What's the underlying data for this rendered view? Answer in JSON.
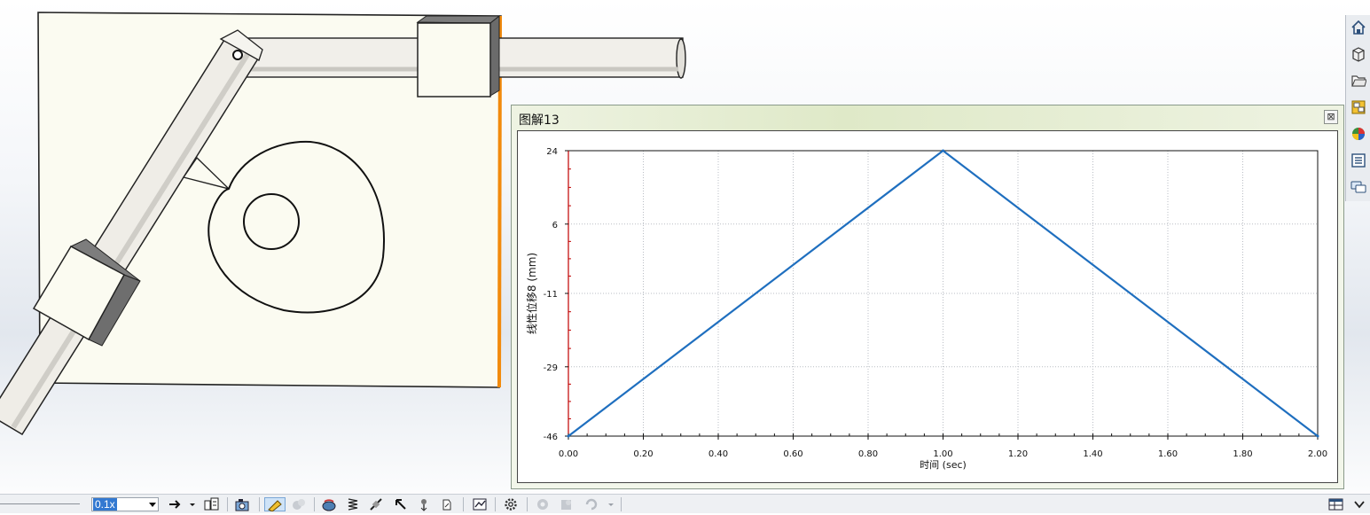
{
  "plot_window": {
    "title": "图解13",
    "close_glyph": "⊠"
  },
  "chart_data": {
    "type": "line",
    "title": "",
    "xlabel": "时间 (sec)",
    "ylabel": "线性位移8 (mm)",
    "xlim": [
      0,
      2
    ],
    "ylim": [
      -46,
      24
    ],
    "x_ticks": [
      0.0,
      0.2,
      0.4,
      0.6,
      0.8,
      1.0,
      1.2,
      1.4,
      1.6,
      1.8,
      2.0
    ],
    "x_tick_labels": [
      "0.00",
      "0.20",
      "0.40",
      "0.60",
      "0.80",
      "1.00",
      "1.20",
      "1.40",
      "1.60",
      "1.80",
      "2.00"
    ],
    "y_ticks": [
      24,
      6,
      -11,
      -29,
      -46
    ],
    "y_tick_labels": [
      "24",
      "6",
      "-11",
      "-29",
      "-46"
    ],
    "grid": true,
    "series": [
      {
        "x": [
          0.0,
          1.0,
          2.0
        ],
        "y": [
          -46,
          24,
          -46
        ],
        "color": "#1f6fbf"
      }
    ]
  },
  "colors": {
    "series_line": "#1f6fbf",
    "left_axis": "#c00000",
    "highlight_edge": "#f28a0c",
    "selection": "#3379d1"
  },
  "bottom_toolbar": {
    "scale_value": "0.1x",
    "icons": [
      "dropdown-arrow-icon",
      "arrow-right-icon",
      "dropdown-arrow-icon",
      "calculate-icon",
      "camera-icon",
      "motion-study-properties-icon",
      "contact-icon",
      "motor-icon",
      "spring-icon",
      "damper-icon",
      "force-icon",
      "gravity-icon",
      "results-plot-icon",
      "settings-icon",
      "copy-study-icon",
      "paste-study-icon",
      "delete-study-icon",
      "dropdown-arrow-icon"
    ]
  },
  "right_toolbar": {
    "icons": [
      "home-icon",
      "part-library-icon",
      "folder-icon",
      "view-palette-icon",
      "appearances-icon",
      "custom-properties-icon",
      "forum-icon"
    ]
  }
}
